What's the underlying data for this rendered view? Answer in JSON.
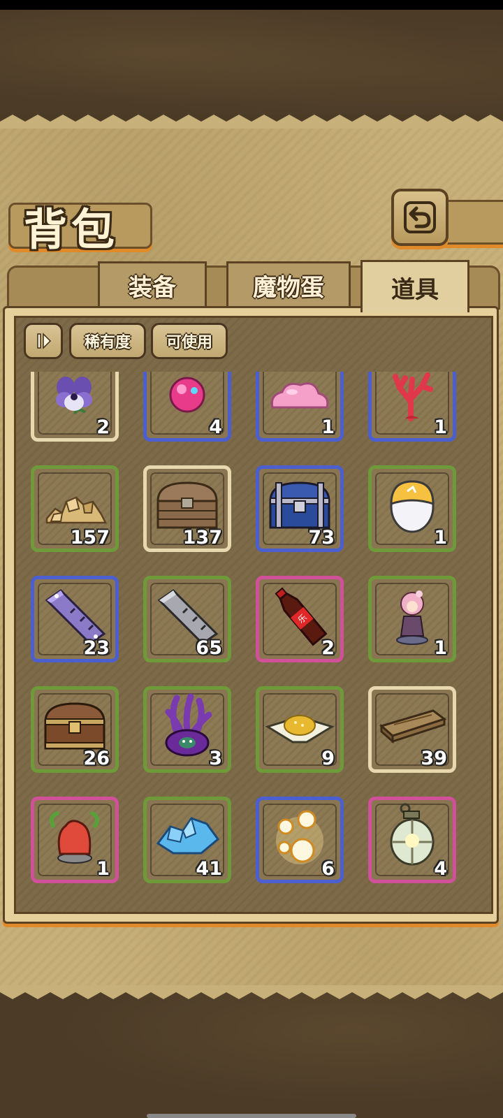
{
  "title": "背包",
  "tabs": [
    {
      "label": "装备",
      "active": false
    },
    {
      "label": "魔物蛋",
      "active": false
    },
    {
      "label": "道具",
      "active": true
    }
  ],
  "filters": {
    "sort_icon": "sort-toggle-icon",
    "rarity": "稀有度",
    "usable": "可使用"
  },
  "rarity_colors": {
    "common": "#e8d8b0",
    "green": "#6e9a3a",
    "blue": "#4b5fd0",
    "pink": "#d0509a"
  },
  "items": [
    {
      "icon": "pansy-flower-icon",
      "count": "2",
      "rarity": "common"
    },
    {
      "icon": "pink-orb-icon",
      "count": "4",
      "rarity": "blue"
    },
    {
      "icon": "pink-slime-icon",
      "count": "1",
      "rarity": "blue"
    },
    {
      "icon": "red-coral-icon",
      "count": "1",
      "rarity": "blue"
    },
    {
      "icon": "gold-ore-pile-icon",
      "count": "157",
      "rarity": "green"
    },
    {
      "icon": "wooden-chest-icon",
      "count": "137",
      "rarity": "common"
    },
    {
      "icon": "blue-chest-icon",
      "count": "73",
      "rarity": "blue"
    },
    {
      "icon": "gold-white-egg-icon",
      "count": "1",
      "rarity": "green"
    },
    {
      "icon": "purple-metal-bar-icon",
      "count": "23",
      "rarity": "blue"
    },
    {
      "icon": "silver-metal-bar-icon",
      "count": "65",
      "rarity": "green"
    },
    {
      "icon": "cola-bottle-icon",
      "count": "2",
      "rarity": "pink"
    },
    {
      "icon": "pink-hair-figure-icon",
      "count": "1",
      "rarity": "green"
    },
    {
      "icon": "brown-chest-icon",
      "count": "26",
      "rarity": "green"
    },
    {
      "icon": "purple-tentacle-monster-icon",
      "count": "3",
      "rarity": "green"
    },
    {
      "icon": "golden-rice-plate-icon",
      "count": "9",
      "rarity": "green"
    },
    {
      "icon": "wooden-plank-icon",
      "count": "39",
      "rarity": "common"
    },
    {
      "icon": "red-rock-statue-icon",
      "count": "1",
      "rarity": "pink"
    },
    {
      "icon": "blue-crystal-pile-icon",
      "count": "41",
      "rarity": "green"
    },
    {
      "icon": "golden-bubbles-icon",
      "count": "6",
      "rarity": "blue"
    },
    {
      "icon": "glass-lantern-icon",
      "count": "4",
      "rarity": "pink"
    }
  ]
}
